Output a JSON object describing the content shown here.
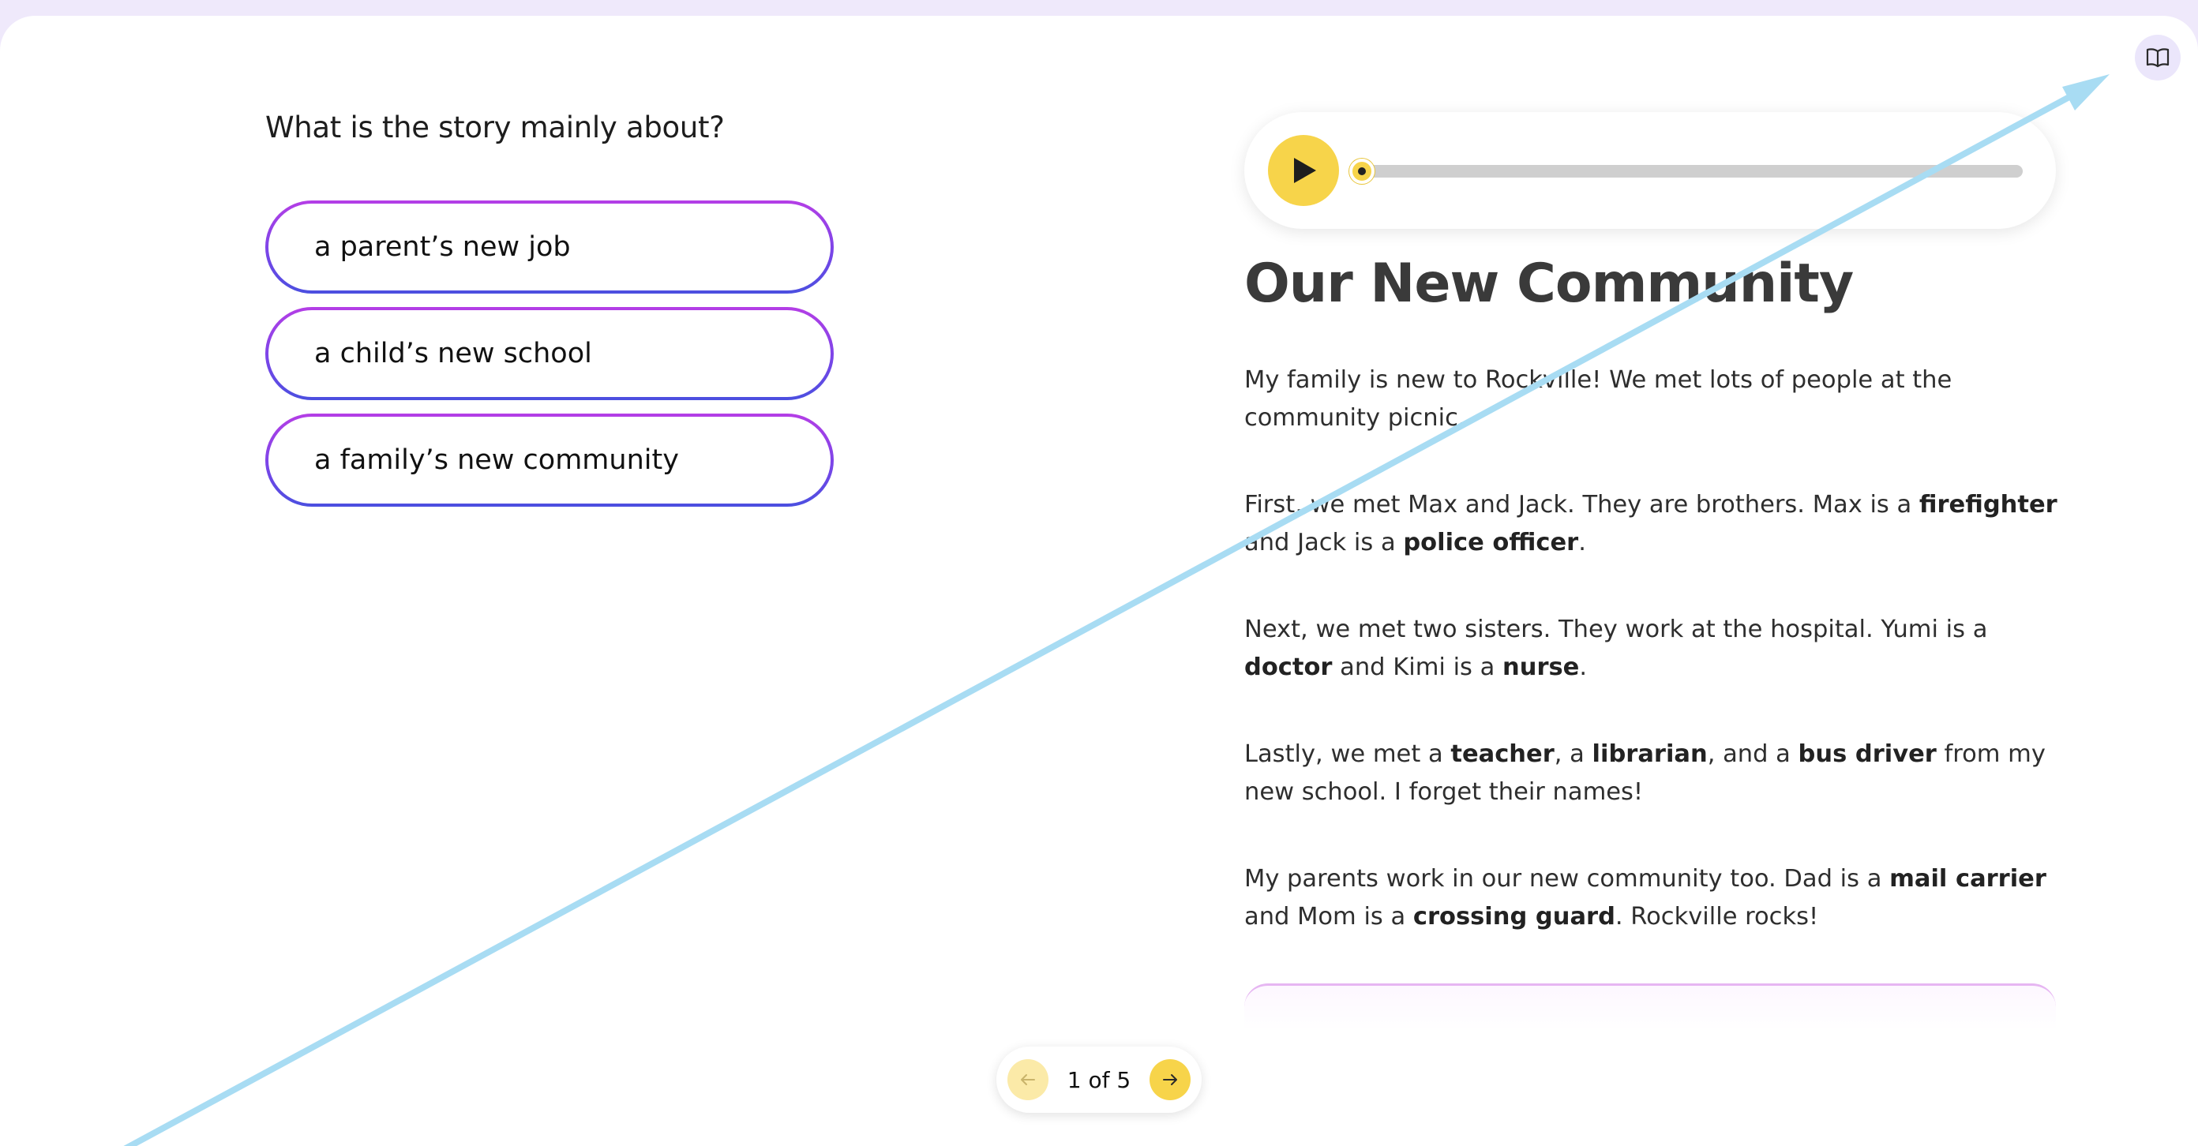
{
  "question": {
    "prompt": "What is the story mainly about?",
    "options": [
      "a parent’s new job",
      "a child’s new school",
      "a family’s new community"
    ]
  },
  "audio": {
    "progress_percent": 0
  },
  "story": {
    "title": "Our New Community",
    "paragraphs": [
      [
        {
          "t": "My family is new to Rockville! We met lots of people at the community picnic."
        }
      ],
      [
        {
          "t": "First, we met Max and Jack. They are brothers. Max is a "
        },
        {
          "t": "firefighter",
          "b": true
        },
        {
          "t": " and Jack is a "
        },
        {
          "t": "police officer",
          "b": true
        },
        {
          "t": "."
        }
      ],
      [
        {
          "t": "Next, we met two sisters. They work at the hospital. Yumi is a "
        },
        {
          "t": "doctor",
          "b": true
        },
        {
          "t": " and Kimi is a "
        },
        {
          "t": "nurse",
          "b": true
        },
        {
          "t": "."
        }
      ],
      [
        {
          "t": "Lastly, we met a "
        },
        {
          "t": "teacher",
          "b": true
        },
        {
          "t": ", a "
        },
        {
          "t": "librarian",
          "b": true
        },
        {
          "t": ", and a "
        },
        {
          "t": "bus driver",
          "b": true
        },
        {
          "t": " from my new school. I forget their names!"
        }
      ],
      [
        {
          "t": "My parents work in our new community too. Dad is a "
        },
        {
          "t": "mail carrier",
          "b": true
        },
        {
          "t": " and Mom is a "
        },
        {
          "t": "crossing guard",
          "b": true
        },
        {
          "t": ". Rockville rocks!"
        }
      ]
    ]
  },
  "pager": {
    "label": "1 of 5",
    "current": 1,
    "total": 5
  },
  "icons": {
    "play": "play-icon",
    "prev": "arrow-left-icon",
    "next": "arrow-right-icon",
    "glossary": "book-icon"
  },
  "colors": {
    "accent_yellow": "#f7d44a",
    "option_border_top": "#b43ee6",
    "option_border_bottom": "#4b4fe0",
    "page_background": "#efe9fb",
    "annotation_arrow": "#a8dcf3"
  }
}
